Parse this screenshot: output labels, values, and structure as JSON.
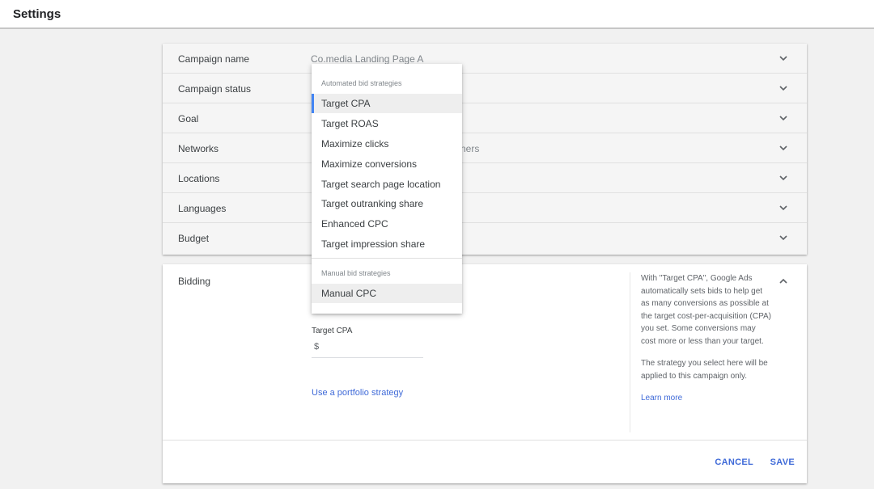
{
  "header": {
    "title": "Settings"
  },
  "settings_rows": [
    {
      "label": "Campaign name",
      "value": "Co.media Landing Page A"
    },
    {
      "label": "Campaign status",
      "value": ""
    },
    {
      "label": "Goal",
      "value": ""
    },
    {
      "label": "Networks",
      "value": "ners"
    },
    {
      "label": "Locations",
      "value": ""
    },
    {
      "label": "Languages",
      "value": ""
    },
    {
      "label": "Budget",
      "value": ""
    }
  ],
  "bidding": {
    "label": "Bidding",
    "target_cpa_label": "Target CPA",
    "currency_symbol": "$",
    "portfolio_link": "Use a portfolio strategy",
    "help_text_1": "With \"Target CPA\", Google Ads automatically sets bids to help get as many conversions as possible at the target cost-per-acquisition (CPA) you set. Some conversions may cost more or less than your target.",
    "help_text_2": "The strategy you select here will be applied to this campaign only.",
    "learn_more": "Learn more",
    "cancel_label": "CANCEL",
    "save_label": "SAVE"
  },
  "dropdown": {
    "automated_header": "Automated bid strategies",
    "automated_items": [
      "Target CPA",
      "Target ROAS",
      "Maximize clicks",
      "Maximize conversions",
      "Target search page location",
      "Target outranking share",
      "Enhanced CPC",
      "Target impression share"
    ],
    "selected_item": "Target CPA",
    "manual_header": "Manual bid strategies",
    "manual_items": [
      "Manual CPC"
    ]
  },
  "colors": {
    "accent_blue": "#3f6ad8",
    "selected_bar": "#4285f4",
    "background": "#f1f1f1"
  }
}
